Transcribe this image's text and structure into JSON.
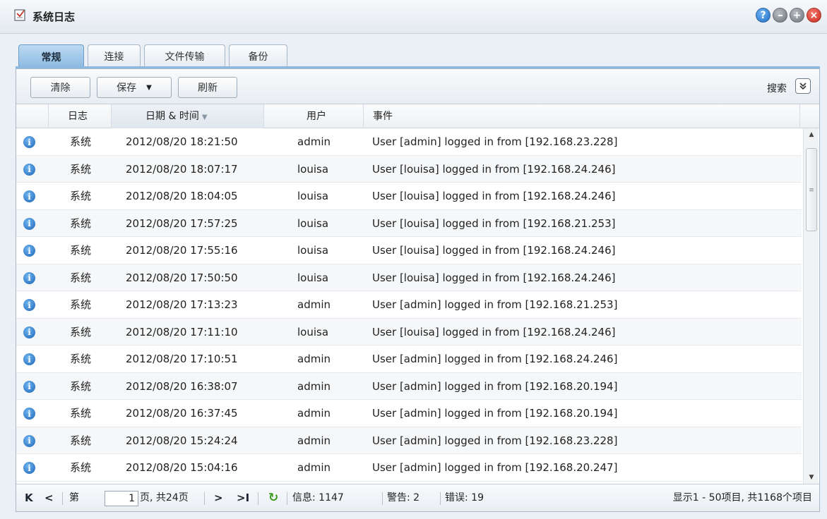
{
  "window": {
    "title": "系统日志",
    "buttons": [
      "?",
      "",
      "+",
      "×"
    ]
  },
  "tabs": [
    {
      "label": "常规",
      "active": true
    },
    {
      "label": "连接",
      "active": false
    },
    {
      "label": "文件传输",
      "active": false
    },
    {
      "label": "备份",
      "active": false
    }
  ],
  "toolbar": {
    "clear_label": "清除",
    "save_label": "保存",
    "refresh_label": "刷新",
    "search_label": "搜索"
  },
  "columns": {
    "log": "日志",
    "datetime": "日期 & 时间",
    "user": "用户",
    "event": "事件"
  },
  "rows": [
    {
      "log": "系统",
      "datetime": "2012/08/20 18:21:50",
      "user": "admin",
      "event": "User [admin] logged in from [192.168.23.228]"
    },
    {
      "log": "系统",
      "datetime": "2012/08/20 18:07:17",
      "user": "louisa",
      "event": "User [louisa] logged in from [192.168.24.246]"
    },
    {
      "log": "系统",
      "datetime": "2012/08/20 18:04:05",
      "user": "louisa",
      "event": "User [louisa] logged in from [192.168.24.246]"
    },
    {
      "log": "系统",
      "datetime": "2012/08/20 17:57:25",
      "user": "louisa",
      "event": "User [louisa] logged in from [192.168.21.253]"
    },
    {
      "log": "系统",
      "datetime": "2012/08/20 17:55:16",
      "user": "louisa",
      "event": "User [louisa] logged in from [192.168.24.246]"
    },
    {
      "log": "系统",
      "datetime": "2012/08/20 17:50:50",
      "user": "louisa",
      "event": "User [louisa] logged in from [192.168.24.246]"
    },
    {
      "log": "系统",
      "datetime": "2012/08/20 17:13:23",
      "user": "admin",
      "event": "User [admin] logged in from [192.168.21.253]"
    },
    {
      "log": "系统",
      "datetime": "2012/08/20 17:11:10",
      "user": "louisa",
      "event": "User [louisa] logged in from [192.168.24.246]"
    },
    {
      "log": "系统",
      "datetime": "2012/08/20 17:10:51",
      "user": "admin",
      "event": "User [admin] logged in from [192.168.24.246]"
    },
    {
      "log": "系统",
      "datetime": "2012/08/20 16:38:07",
      "user": "admin",
      "event": "User [admin] logged in from [192.168.20.194]"
    },
    {
      "log": "系统",
      "datetime": "2012/08/20 16:37:45",
      "user": "admin",
      "event": "User [admin] logged in from [192.168.20.194]"
    },
    {
      "log": "系统",
      "datetime": "2012/08/20 15:24:24",
      "user": "admin",
      "event": "User [admin] logged in from [192.168.23.228]"
    },
    {
      "log": "系统",
      "datetime": "2012/08/20 15:04:16",
      "user": "admin",
      "event": "User [admin] logged in from [192.168.20.247]"
    }
  ],
  "pager": {
    "first": "K",
    "prev": "<",
    "page_prefix": "第",
    "page_value": "1",
    "page_suffix": "页, 共24页",
    "next": ">",
    "last": ">I",
    "info": "信息: 1147",
    "warn": "警告: 2",
    "error": "错误: 19",
    "summary": "显示1 - 50项目, 共1168个项目"
  },
  "colors": {
    "active_tab": "#8ab8e0",
    "info_icon": "#1d64b5",
    "close_button": "#c9261a",
    "refresh_icon": "#3a9a1c"
  }
}
